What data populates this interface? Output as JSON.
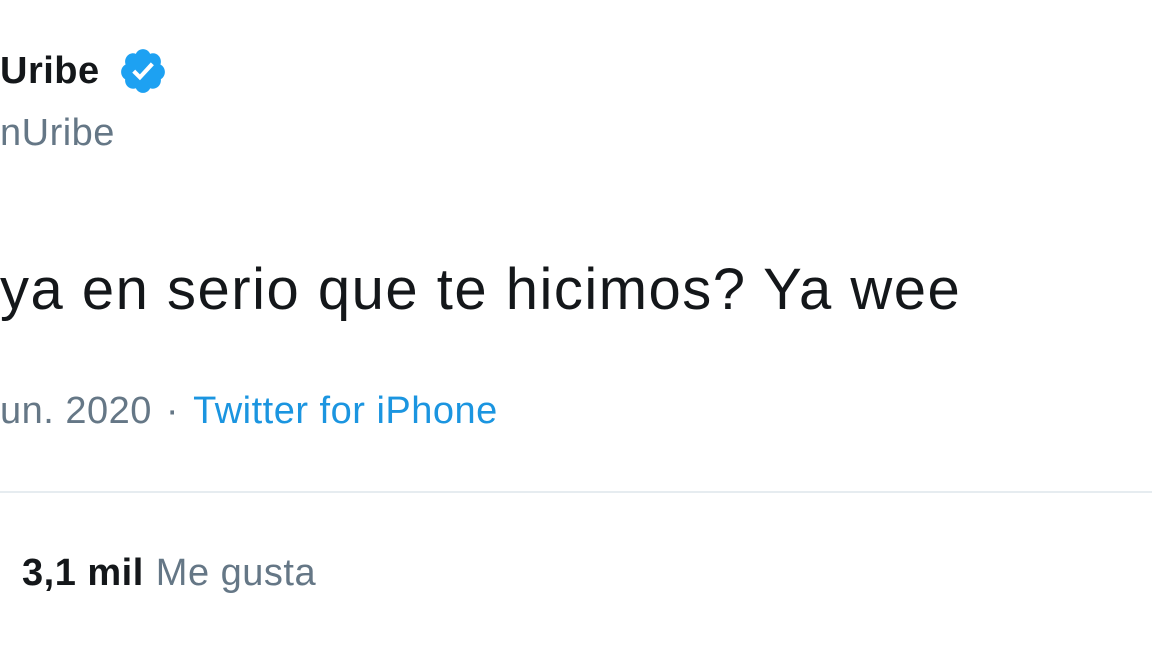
{
  "tweet": {
    "display_name": "Uribe",
    "handle": "nUribe",
    "verified_icon": "verified-badge-icon",
    "text": "ya en serio que te hicimos? Ya wee",
    "date": "un. 2020",
    "separator": "·",
    "source": "Twitter for iPhone",
    "likes_count": "3,1 mil",
    "likes_label": "Me gusta"
  },
  "colors": {
    "accent": "#1da1f2",
    "link": "#1b95e0",
    "text_primary": "#14171a",
    "text_secondary": "#657786",
    "divider": "#e6ecf0"
  }
}
